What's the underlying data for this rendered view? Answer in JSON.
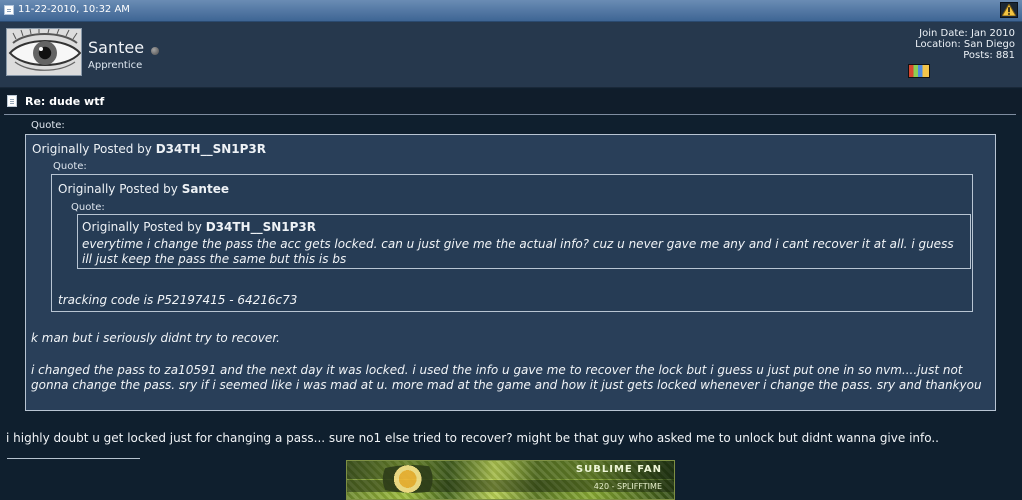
{
  "post": {
    "timestamp": "11-22-2010, 10:32 AM",
    "title": "Re: dude wtf",
    "text": "i highly doubt u get locked just for changing a pass... sure no1 else tried to recover? might be that guy who asked me to unlock but didnt wanna give info.."
  },
  "user": {
    "name": "Santee",
    "rank": "Apprentice",
    "join_date": "Join Date: Jan 2010",
    "location": "Location: San Diego",
    "posts": "Posts: 881"
  },
  "quotes": {
    "label": "Quote:",
    "outer": {
      "originally_posted_by": "Originally Posted by",
      "author": "D34TH__SN1P3R",
      "lines": [
        "k man but i seriously didnt try to recover.",
        "i changed the pass to za10591 and the next day it was locked. i used the info u gave me to recover the lock but i guess u just put one in so nvm....just not gonna change the pass. sry if i seemed like i was mad at u. more mad at the game and how it just gets locked whenever i change the pass. sry and thankyou"
      ]
    },
    "middle": {
      "originally_posted_by": "Originally Posted by",
      "author": "Santee",
      "line": "tracking code is P52197415 - 64216c73"
    },
    "inner": {
      "originally_posted_by": "Originally Posted by",
      "author": "D34TH__SN1P3R",
      "line": "everytime i change the pass the acc gets locked. can u just give me the actual info? cuz u never gave me any and i cant recover it at all. i guess ill just keep the pass the same but this is bs"
    }
  },
  "signature": {
    "banner_title": "SUBLIME FAN",
    "banner_subtitle": "420 - SPLIFFTIME"
  },
  "icons": {
    "post": "document-icon",
    "report": "warning-icon",
    "status": "offline-status-icon",
    "reputation": "reputation-icon"
  },
  "colors": {
    "accent": "#6a8cb4",
    "background": "#0f1f2e",
    "quote_border": "#b8c5d3"
  }
}
